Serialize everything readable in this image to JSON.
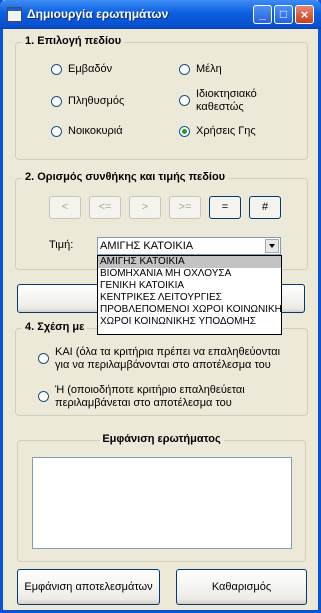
{
  "window": {
    "title": "Δημιουργία ερωτημάτων",
    "controls": {
      "minimize": "_",
      "maximize": "□",
      "close": "×"
    }
  },
  "field_selection": {
    "label": "1. Επιλογή πεδίου",
    "options": [
      {
        "label": "Εμβαδόν",
        "selected": false
      },
      {
        "label": "Μέλη",
        "selected": false
      },
      {
        "label": "Πληθυσμός",
        "selected": false
      },
      {
        "label": "Ιδιοκτησιακό καθεστώς",
        "line1": "Ιδιοκτησιακό",
        "line2": "καθεστώς",
        "selected": false
      },
      {
        "label": "Νοικοκυριά",
        "selected": false
      },
      {
        "label": "Χρήσεις Γης",
        "selected": true
      }
    ]
  },
  "condition": {
    "label": "2. Ορισμός συνθήκης και τιμής πεδίου",
    "operators": [
      {
        "label": "<",
        "enabled": false
      },
      {
        "label": "<=",
        "enabled": false
      },
      {
        "label": ">",
        "enabled": false
      },
      {
        "label": ">=",
        "enabled": false
      },
      {
        "label": "=",
        "enabled": true
      },
      {
        "label": "#",
        "enabled": true
      }
    ],
    "value_label": "Τιμή:",
    "value": "ΑΜΙΓΗΣ ΚΑΤΟΙΚΙΑ",
    "dropdown_options": [
      "ΑΜΙΓΗΣ ΚΑΤΟΙΚΙΑ",
      "ΒΙΟΜΗΧΑΝΙΑ ΜΗ ΟΧΛΟΥΣΑ",
      "ΓΕΝΙΚΗ ΚΑΤΟΙΚΙΑ",
      "ΚΕΝΤΡΙΚΕΣ ΛΕΙΤΟΥΡΓΙΕΣ",
      "ΠΡΟΒΛΕΠΟΜΕΝΟΙ ΧΩΡΟΙ ΚΟΙΝΩΝΙΚΗΣ",
      "ΧΩΡΟΙ ΚΟΙΝΩΝΙΚΗΣ ΥΠΟΔΟΜΗΣ"
    ],
    "dropdown_selected": 0
  },
  "relation": {
    "label": "4. Σχέση με",
    "options": [
      {
        "line1": "ΚΑΙ  (όλα τα κριτήρια πρέπει να επαληθεύονται",
        "line2": "για να περιλαμβάνονται στο αποτέλεσμα του",
        "selected": false
      },
      {
        "line1": "Ή  (οποιοδήποτε κριτήριο επαληθεύεται",
        "line2": "περιλαμβάνεται στο αποτέλεσμα του",
        "selected": false
      }
    ]
  },
  "query_display": {
    "label": "Εμφάνιση ερωτήματος",
    "text": ""
  },
  "buttons": {
    "show_results": "Εμφάνιση αποτελεσμάτων",
    "clear": "Καθαρισμός"
  }
}
